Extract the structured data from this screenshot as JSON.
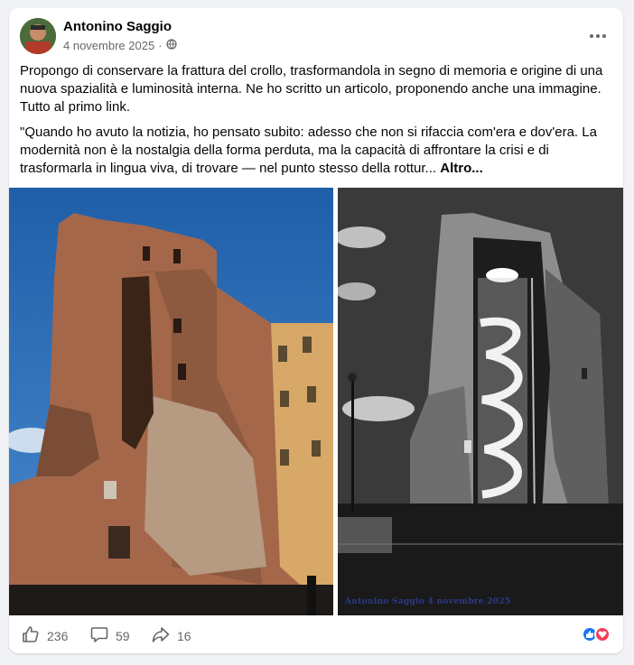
{
  "post": {
    "author": "Antonino Saggio",
    "date": "4 novembre 2025",
    "separator": "·",
    "paragraph1": "Propongo  di conservare la frattura del crollo, trasformandola in segno di memoria e origine di una nuova spazialità e luminosità interna. Ne ho scritto un articolo, proponendo anche una immagine. Tutto al primo link.",
    "paragraph2": "\"Quando ho avuto la notizia, ho pensato subito: adesso che non si rifaccia com'era e dov'era. La modernità non è la nostalgia della forma perduta, ma la capacità di affrontare la crisi e di trasformarla in lingua viva, di trovare — nel punto stesso della rottur...",
    "more_label": "Altro...",
    "watermark": "Antonino Saggio 4 novembre 2025"
  },
  "actions": {
    "like_count": "236",
    "comment_count": "59",
    "share_count": "16"
  },
  "icons": {
    "privacy": "globe-icon",
    "menu": "more-horizontal-icon",
    "like": "thumbs-up-icon",
    "comment": "comment-icon",
    "share": "share-icon",
    "reaction_like": "like-reaction-icon",
    "reaction_love": "love-reaction-icon"
  },
  "colors": {
    "background": "#f0f2f5",
    "card": "#ffffff",
    "secondary_text": "#65676b",
    "like_blue": "#1877f2",
    "love_red": "#f33e58"
  }
}
